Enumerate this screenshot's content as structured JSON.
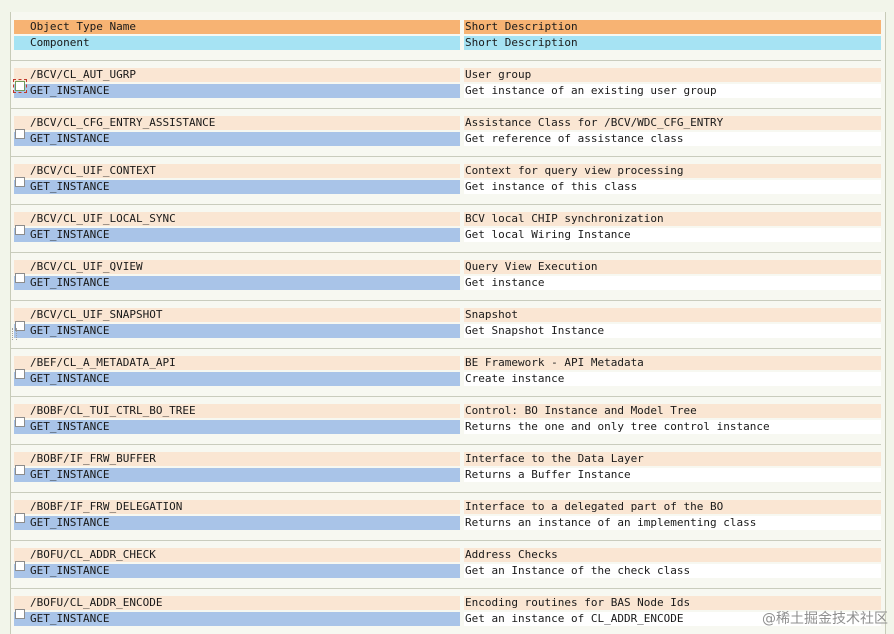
{
  "header": {
    "object_type_label": "Object Type Name",
    "short_desc_label": "Short Description",
    "component_label": "Component",
    "component_desc_label": "Short Description"
  },
  "entries": [
    {
      "object": "/BCV/CL_AUT_UGRP",
      "object_desc": "User group",
      "component": "GET_INSTANCE",
      "component_desc": "Get instance of an existing user group"
    },
    {
      "object": "/BCV/CL_CFG_ENTRY_ASSISTANCE",
      "object_desc": "Assistance Class for /BCV/WDC_CFG_ENTRY",
      "component": "GET_INSTANCE",
      "component_desc": "Get reference of assistance class"
    },
    {
      "object": "/BCV/CL_UIF_CONTEXT",
      "object_desc": "Context for query view processing",
      "component": "GET_INSTANCE",
      "component_desc": "Get instance of this class"
    },
    {
      "object": "/BCV/CL_UIF_LOCAL_SYNC",
      "object_desc": "BCV local CHIP synchronization",
      "component": "GET_INSTANCE",
      "component_desc": "Get local Wiring Instance"
    },
    {
      "object": "/BCV/CL_UIF_QVIEW",
      "object_desc": "Query View Execution",
      "component": "GET_INSTANCE",
      "component_desc": "Get instance"
    },
    {
      "object": "/BCV/CL_UIF_SNAPSHOT",
      "object_desc": "Snapshot",
      "component": "GET_INSTANCE",
      "component_desc": "Get Snapshot Instance"
    },
    {
      "object": "/BEF/CL_A_METADATA_API",
      "object_desc": "BE Framework - API Metadata",
      "component": "GET_INSTANCE",
      "component_desc": "Create instance"
    },
    {
      "object": "/BOBF/CL_TUI_CTRL_BO_TREE",
      "object_desc": "Control: BO Instance and Model Tree",
      "component": "GET_INSTANCE",
      "component_desc": "Returns the one and only tree control instance"
    },
    {
      "object": "/BOBF/IF_FRW_BUFFER",
      "object_desc": "Interface to the Data Layer",
      "component": "GET_INSTANCE",
      "component_desc": "Returns a Buffer Instance"
    },
    {
      "object": "/BOBF/IF_FRW_DELEGATION",
      "object_desc": "Interface to a delegated part of the BO",
      "component": "GET_INSTANCE",
      "component_desc": "Returns an instance of an implementing class"
    },
    {
      "object": "/BOFU/CL_ADDR_CHECK",
      "object_desc": "Address Checks",
      "component": "GET_INSTANCE",
      "component_desc": "Get an Instance of the check class"
    },
    {
      "object": "/BOFU/CL_ADDR_ENCODE",
      "object_desc": "Encoding routines for BAS Node Ids",
      "component": "GET_INSTANCE",
      "component_desc": "Get an instance of CL_ADDR_ENCODE"
    }
  ],
  "watermark": "@稀土掘金技术社区"
}
